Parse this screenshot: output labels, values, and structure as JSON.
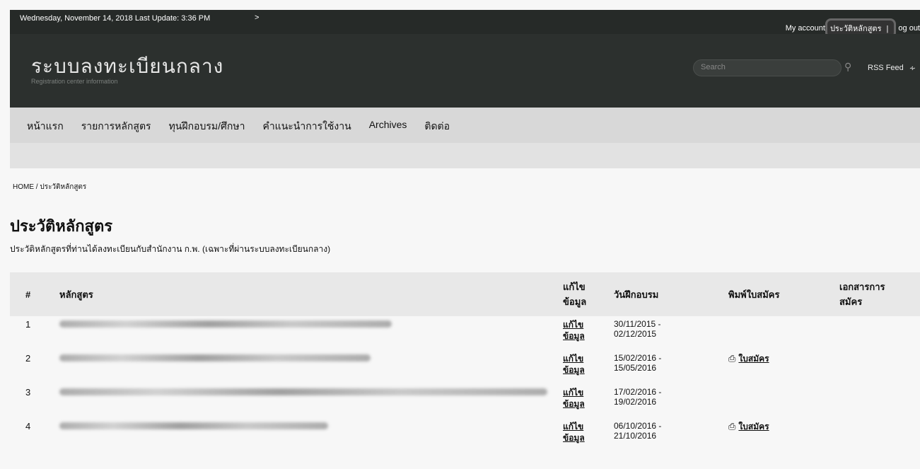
{
  "topbar": {
    "date_text": "Wednesday, November 14, 2018 Last Update: 3:36 PM",
    "arrow": ">",
    "my_account": "My account",
    "course_history": "ประวัติหลักสูตร",
    "separator": "|",
    "logout": "og out"
  },
  "header": {
    "site_title": "ระบบลงทะเบียนกลาง",
    "site_subtitle": "Registration center information",
    "search_placeholder": "Search",
    "rss_label": "RSS Feed"
  },
  "nav": {
    "items": [
      {
        "label": "หน้าแรก"
      },
      {
        "label": "รายการหลักสูตร"
      },
      {
        "label": "ทุนฝึกอบรม/ศึกษา"
      },
      {
        "label": "คำแนะนำการใช้งาน"
      },
      {
        "label": "Archives"
      },
      {
        "label": "ติดต่อ"
      }
    ]
  },
  "breadcrumb": {
    "home": "HOME",
    "separator": "/",
    "current": "ประวัติหลักสูตร"
  },
  "page": {
    "title": "ประวัติหลักสูตร",
    "description": "ประวัติหลักสูตรที่ท่านได้ลงทะเบียนกับสำนักงาน ก.พ. (เฉพาะที่ผ่านระบบลงทะเบียนกลาง)"
  },
  "table": {
    "headers": {
      "num": "#",
      "course": "หลักสูตร",
      "edit_line1": "แก้ไข",
      "edit_line2": "ข้อมูล",
      "date": "วันฝึกอบรม",
      "print": "พิมพ์ใบสมัคร",
      "docs_line1": "เอกสารการ",
      "docs_line2": "สมัคร"
    },
    "rows": [
      {
        "num": "1",
        "edit_line1": "แก้ไข",
        "edit_line2": "ข้อมูล",
        "date_start": "30/11/2015 -",
        "date_end": "02/12/2015",
        "print_label": ""
      },
      {
        "num": "2",
        "edit_line1": "แก้ไข",
        "edit_line2": "ข้อมูล",
        "date_start": "15/02/2016 -",
        "date_end": "15/05/2016",
        "print_label": "ใบสมัคร"
      },
      {
        "num": "3",
        "edit_line1": "แก้ไข",
        "edit_line2": "ข้อมูล",
        "date_start": "17/02/2016 -",
        "date_end": "19/02/2016",
        "print_label": ""
      },
      {
        "num": "4",
        "edit_line1": "แก้ไข",
        "edit_line2": "ข้อมูล",
        "date_start": "06/10/2016 -",
        "date_end": "21/10/2016",
        "print_label": "ใบสมัคร"
      }
    ]
  },
  "icons": {
    "print": "printer-icon",
    "rss": "rss-icon",
    "search": "search-icon"
  }
}
